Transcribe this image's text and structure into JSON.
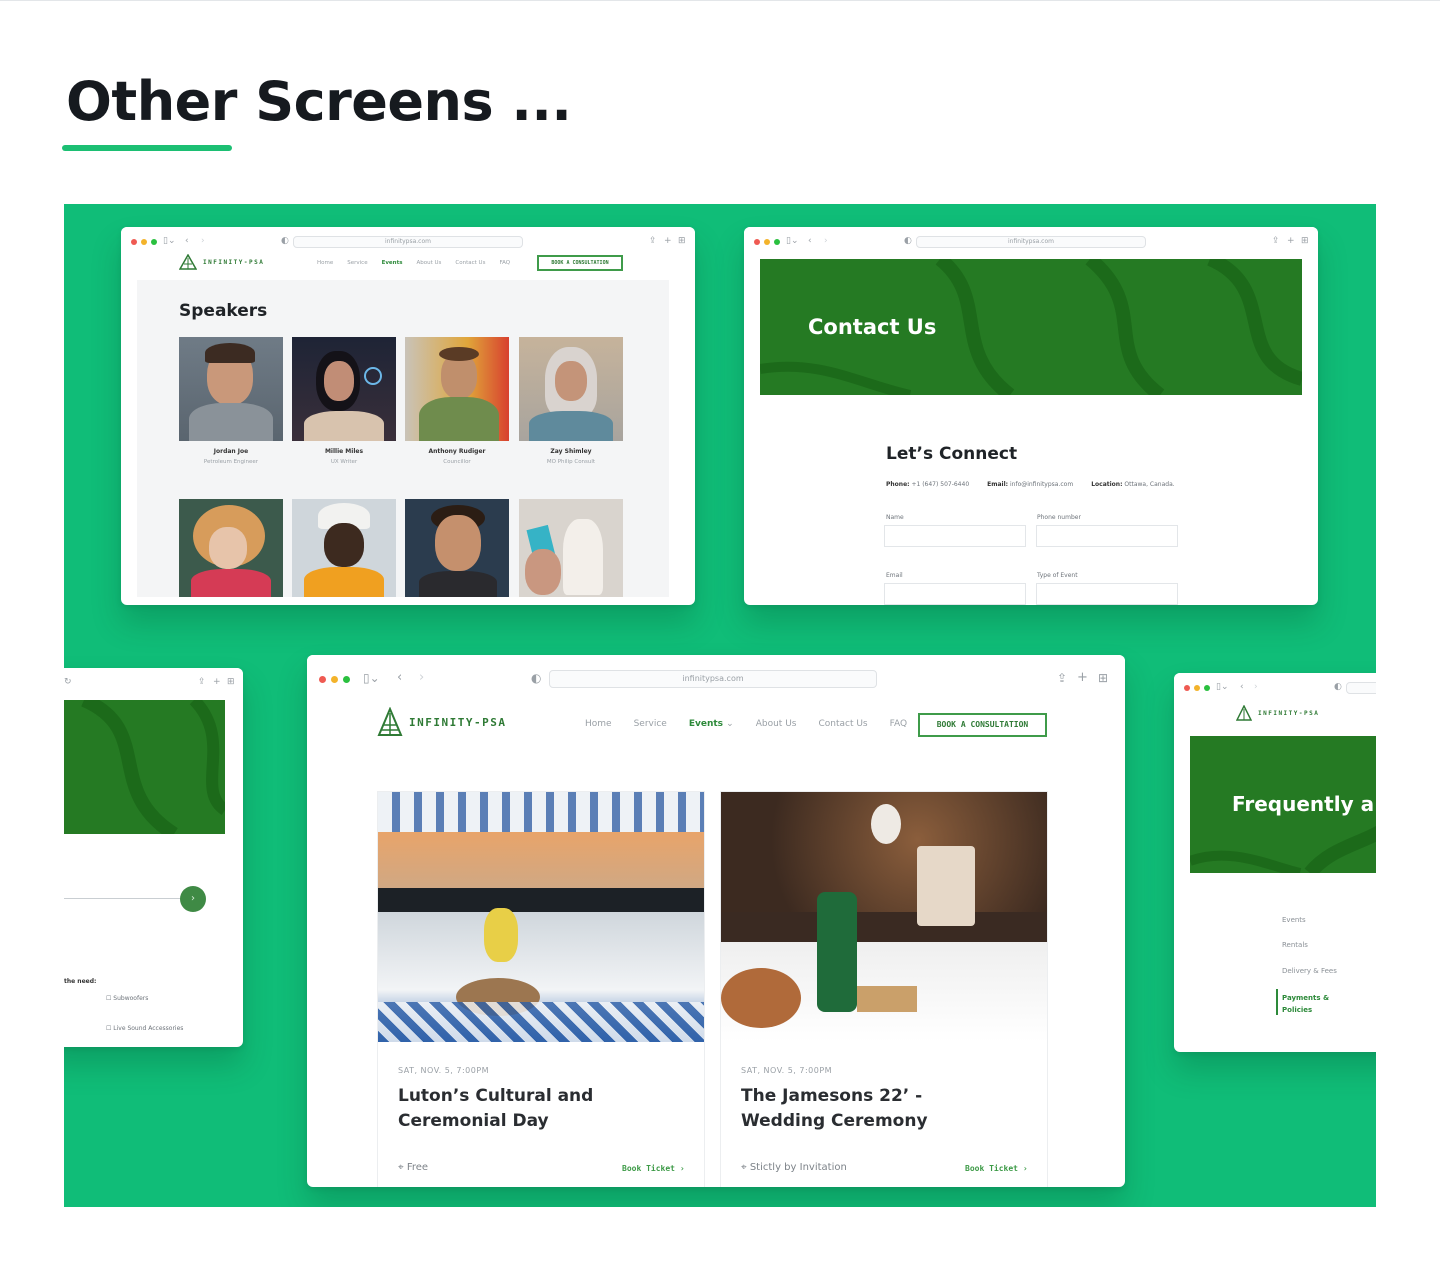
{
  "page": {
    "title": "Other Screens ..."
  },
  "colors": {
    "accent": "#1cbf73",
    "stage_bg": "#10bd78",
    "brand_green": "#257a23",
    "text_green": "#2f7a35"
  },
  "browser": {
    "url": "infinitypsa.com"
  },
  "brand": {
    "logo_text": "INFINITY-PSA",
    "nav_items": [
      {
        "label": "Home"
      },
      {
        "label": "Service"
      },
      {
        "label": "Events"
      },
      {
        "label": "About Us"
      },
      {
        "label": "Contact Us"
      },
      {
        "label": "FAQ"
      }
    ],
    "cta_label": "BOOK A CONSULTATION"
  },
  "speakers_screen": {
    "heading": "Speakers",
    "speakers": [
      {
        "name": "Jordan Joe",
        "role": "Petroleum Engineer"
      },
      {
        "name": "Millie Miles",
        "role": "UX Writer"
      },
      {
        "name": "Anthony Rudiger",
        "role": "Councillor"
      },
      {
        "name": "Zay Shimley",
        "role": "MO Philip Consult"
      }
    ]
  },
  "contact_screen": {
    "hero_title": "Contact Us",
    "section_title": "Let’s Connect",
    "info": {
      "phone_label": "Phone:",
      "phone": "+1 (647) 507-6440",
      "email_label": "Email:",
      "email": "info@infinitypsa.com",
      "location_label": "Location:",
      "location": "Ottawa, Canada."
    },
    "fields": {
      "name": "Name",
      "phone": "Phone number",
      "email": "Email",
      "type": "Type of Event"
    }
  },
  "rental_screen": {
    "prompt": "the need:",
    "options": [
      "Subwoofers",
      "Live Sound Accessories"
    ]
  },
  "events_screen": {
    "events": [
      {
        "date": "SAT, NOV. 5, 7:00PM",
        "title": "Luton’s Cultural and Ceremonial Day",
        "price": "Free",
        "link": "Book Ticket"
      },
      {
        "date": "SAT, NOV. 5, 7:00PM",
        "title": "The Jamesons 22’ - Wedding Ceremony",
        "price": "Stictly by Invitation",
        "link": "Book Ticket"
      }
    ]
  },
  "faq_screen": {
    "hero_title": "Frequently a",
    "categories": [
      {
        "label": "Events"
      },
      {
        "label": "Rentals"
      },
      {
        "label": "Delivery & Fees"
      },
      {
        "label": "Payments & Policies"
      }
    ]
  }
}
